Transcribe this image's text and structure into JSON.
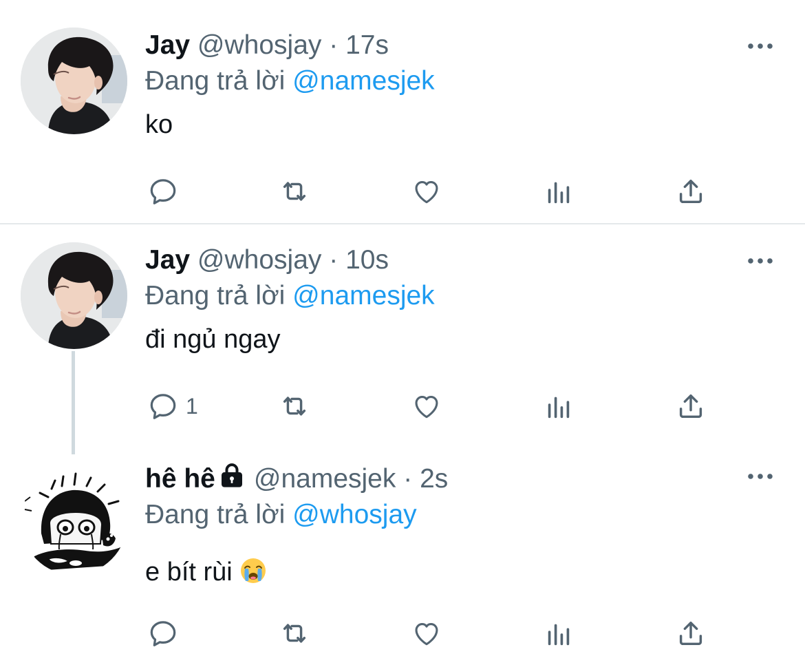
{
  "tweets": [
    {
      "display_name": "Jay",
      "handle": "@whosjay",
      "separator": "·",
      "time": "17s",
      "reply_prefix": "Đang trả lời",
      "reply_to": "@namesjek",
      "text": "ko",
      "reply_count": "",
      "avatar": "profile-photo-dark-hair-person",
      "protected": false
    },
    {
      "display_name": "Jay",
      "handle": "@whosjay",
      "separator": "·",
      "time": "10s",
      "reply_prefix": "Đang trả lời",
      "reply_to": "@namesjek",
      "text": "đi ngủ ngay",
      "reply_count": "1",
      "avatar": "profile-photo-dark-hair-person",
      "protected": false
    },
    {
      "display_name": "hê hê",
      "handle": "@namesjek",
      "separator": "·",
      "time": "2s",
      "reply_prefix": "Đang trả lời",
      "reply_to": "@whosjay",
      "text": "e bít rùi",
      "emoji": "loudly-crying-face",
      "reply_count": "",
      "avatar": "manga-crying-character-sketch",
      "protected": true
    }
  ],
  "icons": {
    "reply": "speech-bubble-icon",
    "retweet": "retweet-icon",
    "like": "heart-icon",
    "views": "bar-chart-icon",
    "share": "share-upload-icon",
    "more": "ellipsis-icon",
    "lock": "lock-icon"
  },
  "colors": {
    "link": "#1d9bf0",
    "secondary_text": "#536471",
    "primary_text": "#0f1419",
    "divider": "#e4e8eb",
    "thread_line": "#cfd9de"
  }
}
